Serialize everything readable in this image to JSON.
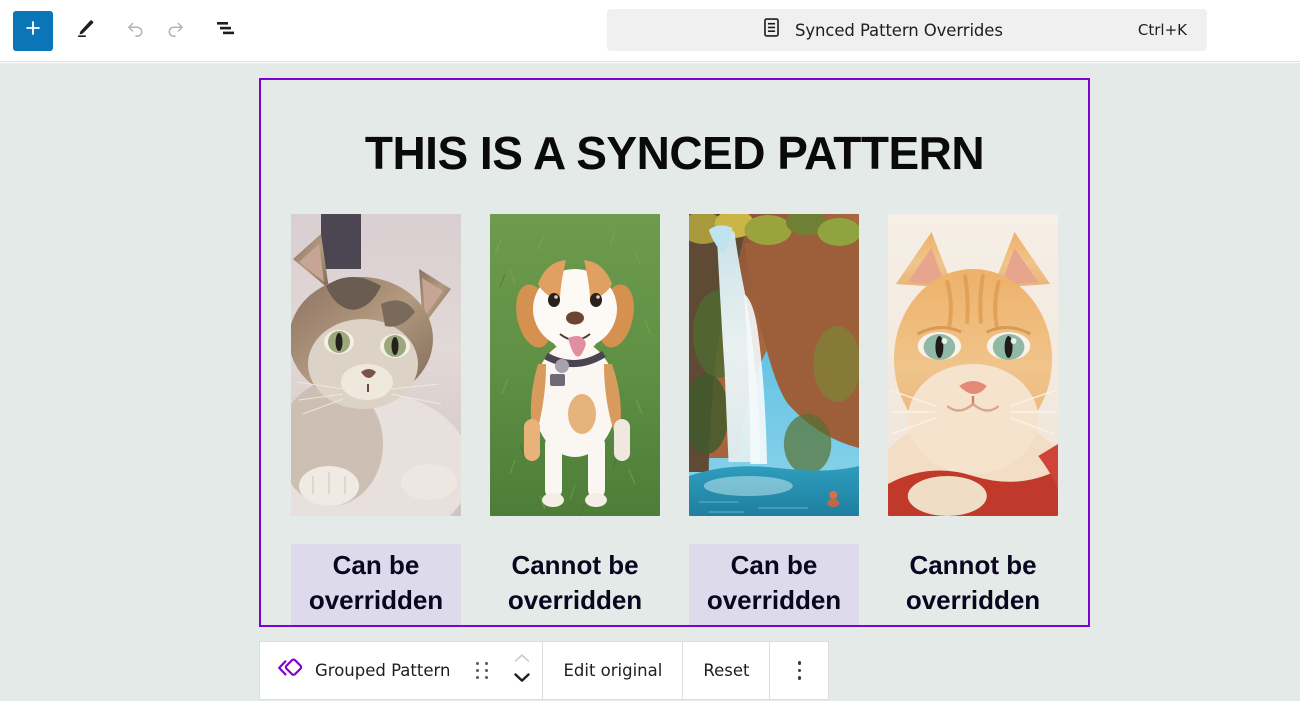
{
  "header": {
    "add_block_label": "+",
    "tools": [
      {
        "name": "add-block-button",
        "icon": "plus-icon",
        "label": "Add block"
      },
      {
        "name": "edit-tool-button",
        "icon": "pencil-icon",
        "label": "Edit"
      },
      {
        "name": "undo-button",
        "icon": "undo-icon",
        "label": "Undo"
      },
      {
        "name": "redo-button",
        "icon": "redo-icon",
        "label": "Redo"
      },
      {
        "name": "list-view-button",
        "icon": "list-view-icon",
        "label": "Document Overview"
      }
    ]
  },
  "command_bar": {
    "icon": "document-list-icon",
    "label": "Synced Pattern Overrides",
    "shortcut": "Ctrl+K"
  },
  "pattern": {
    "title": "THIS IS A SYNCED PATTERN",
    "border_color": "#7b04d4",
    "canvas_color": "#e4eae7",
    "override_highlight_color": "#dcdaeb",
    "columns": [
      {
        "image_alt": "calico-tabby-cat-lying-down",
        "caption": "Can be overridden",
        "overridable": true
      },
      {
        "image_alt": "beagle-dog-sitting-on-grass",
        "caption": "Cannot be overridden",
        "overridable": false
      },
      {
        "image_alt": "waterfall-into-turquoise-pool",
        "caption": "Can be overridden",
        "overridable": true
      },
      {
        "image_alt": "orange-tabby-cat-looking-up",
        "caption": "Cannot be overridden",
        "overridable": false
      }
    ]
  },
  "block_toolbar": {
    "block_type_label": "Grouped Pattern",
    "block_type_icon": "pattern-diamonds-icon",
    "drag_handle_icon": "drag-handle-icon",
    "move_up_icon": "chevron-up-icon",
    "move_down_icon": "chevron-down-icon",
    "edit_original_label": "Edit original",
    "reset_label": "Reset",
    "more_options_icon": "ellipsis-vertical-icon"
  }
}
